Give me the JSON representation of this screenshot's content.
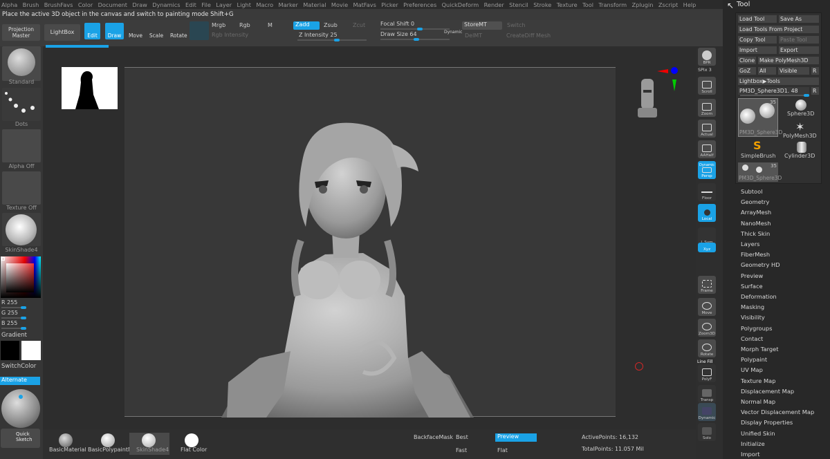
{
  "menu": [
    "Alpha",
    "Brush",
    "BrushFavs",
    "Color",
    "Document",
    "Draw",
    "Dynamics",
    "Edit",
    "File",
    "Layer",
    "Light",
    "Macro",
    "Marker",
    "Material",
    "Movie",
    "MatFavs",
    "Picker",
    "Preferences",
    "QuickDeform",
    "Render",
    "Stencil",
    "Stroke",
    "Texture",
    "Tool",
    "Transform",
    "Zplugin",
    "Zscript",
    "Help"
  ],
  "hint": "Place the active 3D object in the canvas and switch to painting mode Shift+G",
  "toolbar": {
    "projection": "Projection Master",
    "lightbox": "LightBox",
    "edit": "Edit",
    "draw": "Draw",
    "move": "Move",
    "scale": "Scale",
    "rotate": "Rotate",
    "mrgb": "Mrgb",
    "rgb": "Rgb",
    "m": "M",
    "rgb_intensity": "Rgb Intensity",
    "zadd": "Zadd",
    "zsub": "Zsub",
    "zcut": "Zcut",
    "z_intensity": "Z Intensity 25",
    "focal_shift": "Focal Shift 0",
    "draw_size": "Draw Size 64",
    "dynamic": "Dynamic",
    "storemt": "StoreMT",
    "delmt": "DelMT",
    "switch": "Switch",
    "creatediff": "CreateDiff Mesh",
    "z_intensity_level": 0.25,
    "draw_size_level": 0.5
  },
  "left": {
    "brush": "Standard",
    "stroke": "Dots",
    "alpha": "Alpha Off",
    "texture": "Texture Off",
    "material": "SkinShade4",
    "r": "R 255",
    "g": "G 255",
    "b": "B 255",
    "gradient": "Gradient",
    "switchcolor": "SwitchColor",
    "alternate": "Alternate",
    "quicksketch": "Quick Sketch"
  },
  "right": {
    "bpr": "BPR",
    "spix": "SPix 3",
    "scroll": "Scroll",
    "zoom": "Zoom",
    "actual": "Actual",
    "aahalf": "AAHalf",
    "dynamic": "Dynamic",
    "persp": "Persp",
    "floor": "Floor",
    "local": "Local",
    "lsym": "L.Sym",
    "xyz": "Xyz",
    "frame": "Frame",
    "move": "Move",
    "zoom3d": "Zoom3D",
    "rotate": "Rotate",
    "linefill": "Line Fill",
    "polyf": "PolyF",
    "transp": "Transp",
    "dynamic2": "Dynamic",
    "solo": "Solo"
  },
  "tray": {
    "title": "Tool",
    "load": "Load Tool",
    "saveas": "Save As",
    "loadproject": "Load Tools From Project",
    "copy": "Copy Tool",
    "paste": "Paste Tool",
    "import": "Import",
    "export": "Export",
    "clone": "Clone",
    "makepoly": "Make PolyMesh3D",
    "goz": "GoZ",
    "all": "All",
    "visible": "Visible",
    "r": "R",
    "lightbox": "Lightbox▶Tools",
    "current": "PM3D_Sphere3D1. 48",
    "r2": "R",
    "count": "35",
    "item1": "PM3D_Sphere3D",
    "item2": "Sphere3D",
    "item3": "PolyMesh3D",
    "item4": "SimpleBrush",
    "item5": "Cylinder3D",
    "item6": "PM3D_Sphere3D",
    "count2": "35"
  },
  "subpalettes": [
    "Subtool",
    "Geometry",
    "ArrayMesh",
    "NanoMesh",
    "Thick Skin",
    "Layers",
    "FiberMesh",
    "Geometry HD",
    "Preview",
    "Surface",
    "Deformation",
    "Masking",
    "Visibility",
    "Polygroups",
    "Contact",
    "Morph Target",
    "Polypaint",
    "UV Map",
    "Texture Map",
    "Displacement Map",
    "Normal Map",
    "Vector Displacement Map",
    "Display Properties",
    "Unified Skin",
    "Initialize",
    "Import"
  ],
  "bottom": {
    "m1": "BasicMaterial",
    "m2": "BasicPolypaintM",
    "m3": "SkinShade4",
    "m4": "Flat Color",
    "backface": "BackfaceMask",
    "best": "Best",
    "preview": "Preview",
    "fast": "Fast",
    "flat": "Flat",
    "active": "ActivePoints: 16,132",
    "total": "TotalPoints: 11.057 Mil"
  }
}
